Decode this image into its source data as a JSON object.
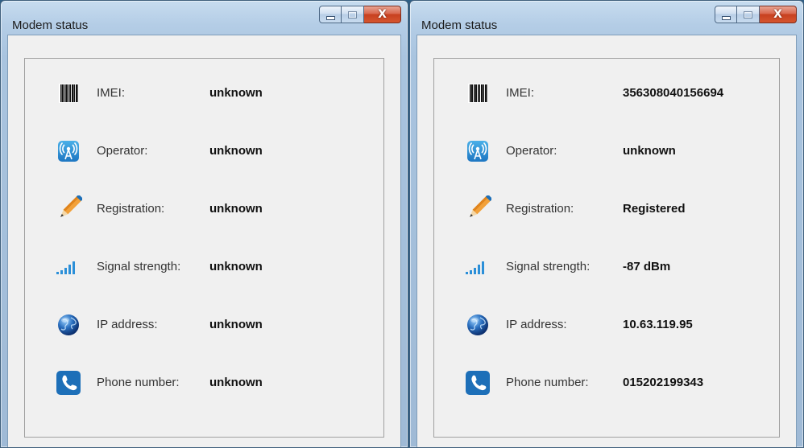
{
  "windows": [
    {
      "title": "Modem status",
      "rows": [
        {
          "icon": "barcode-icon",
          "label": "IMEI:",
          "value": "unknown"
        },
        {
          "icon": "antenna-icon",
          "label": "Operator:",
          "value": "unknown"
        },
        {
          "icon": "pencil-icon",
          "label": "Registration:",
          "value": "unknown"
        },
        {
          "icon": "signal-bars-icon",
          "label": "Signal strength:",
          "value": "unknown"
        },
        {
          "icon": "globe-icon",
          "label": "IP address:",
          "value": "unknown"
        },
        {
          "icon": "phone-icon",
          "label": "Phone number:",
          "value": "unknown"
        }
      ]
    },
    {
      "title": "Modem status",
      "rows": [
        {
          "icon": "barcode-icon",
          "label": "IMEI:",
          "value": "356308040156694"
        },
        {
          "icon": "antenna-icon",
          "label": "Operator:",
          "value": "unknown"
        },
        {
          "icon": "pencil-icon",
          "label": "Registration:",
          "value": "Registered"
        },
        {
          "icon": "signal-bars-icon",
          "label": "Signal strength:",
          "value": "-87 dBm"
        },
        {
          "icon": "globe-icon",
          "label": "IP address:",
          "value": "10.63.119.95"
        },
        {
          "icon": "phone-icon",
          "label": "Phone number:",
          "value": "015202199343"
        }
      ]
    }
  ],
  "caption_buttons": {
    "close_glyph": "X"
  },
  "colors": {
    "accent_blue": "#1d6fb8",
    "window_frame": "#b4cde6",
    "close_red": "#c7401f"
  }
}
